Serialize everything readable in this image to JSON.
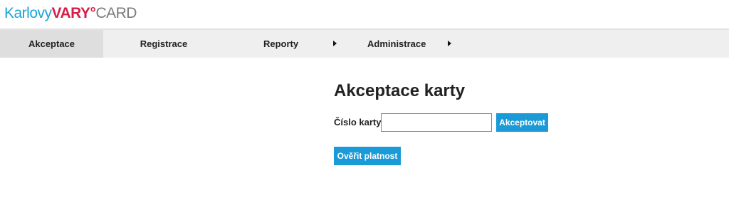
{
  "logo": {
    "part1": "Karlovy",
    "part2": "VARY°",
    "part3": "CARD"
  },
  "nav": {
    "items": [
      {
        "label": "Akceptace"
      },
      {
        "label": "Registrace"
      },
      {
        "label": "Reporty"
      },
      {
        "label": "Administrace"
      }
    ]
  },
  "main": {
    "title": "Akceptace karty",
    "card_label": "Číslo karty",
    "card_value": "",
    "accept_button": "Akceptovat",
    "verify_button": "Ověřit platnost"
  },
  "colors": {
    "accent": "#1a9ad6",
    "logo_blue": "#1aa3d9",
    "logo_red": "#d6204a"
  }
}
